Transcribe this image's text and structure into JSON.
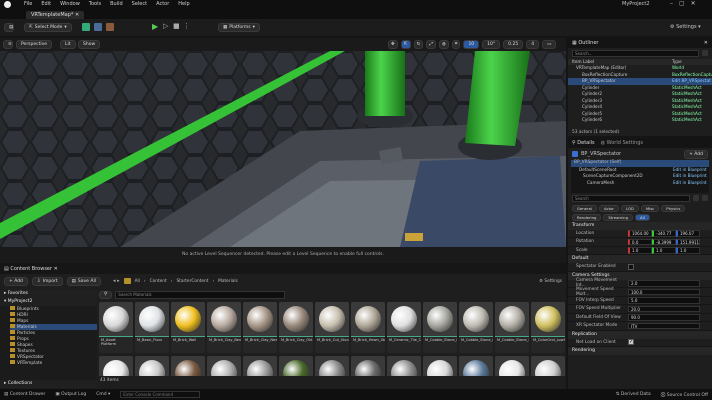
{
  "menu": [
    "File",
    "Edit",
    "Window",
    "Tools",
    "Build",
    "Select",
    "Actor",
    "Help"
  ],
  "project_name": "MyProject2",
  "level_tab": "VRTemplateMap*",
  "toolbar": {
    "select_mode": "Select Mode",
    "platforms": "Platforms",
    "settings": "Settings"
  },
  "viewport": {
    "perspective": "Perspective",
    "lit": "Lit",
    "show": "Show",
    "grid_value": "10",
    "rot_value": "10°",
    "scale_value": "0.25",
    "cam_speed": "4",
    "sequencer_msg": "No active Level Sequencer detected. Please edit a Level Sequence to enable full controls."
  },
  "outliner": {
    "title": "Outliner",
    "search": "Search...",
    "col_label": "Item Label",
    "col_type": "Type",
    "rows": [
      {
        "name": "VRTemplateMap (Editor)",
        "type": "World"
      },
      {
        "name": "BoxReflectionCapture",
        "type": "BoxReflectionCaptu"
      },
      {
        "name": "BP_VRSpectator",
        "type": "Edit BP_VRSpectat"
      },
      {
        "name": "Cylinder",
        "type": "StaticMeshAct"
      },
      {
        "name": "Cylinder2",
        "type": "StaticMeshAct"
      },
      {
        "name": "Cylinder3",
        "type": "StaticMeshAct"
      },
      {
        "name": "Cylinder4",
        "type": "StaticMeshAct"
      },
      {
        "name": "Cylinder5",
        "type": "StaticMeshAct"
      },
      {
        "name": "Cylinder6",
        "type": "StaticMeshAct"
      }
    ],
    "status": "53 actors (1 selected)"
  },
  "details": {
    "tab_details": "Details",
    "tab_world": "World Settings",
    "actor": "BP_VRSpectator",
    "add": "+ Add",
    "self": "BP_VRSpectator (Self)",
    "components": [
      {
        "name": "DefaultSceneRoot",
        "link": "Edit in Blueprint"
      },
      {
        "name": "SceneCaptureComponent2D",
        "link": "Edit in Blueprint"
      },
      {
        "name": "CameraMesh",
        "link": "Edit in Blueprint"
      }
    ],
    "search": "Search",
    "filters1": [
      "General",
      "Actor",
      "LOD",
      "Misc",
      "Physics"
    ],
    "filters2": [
      "Rendering",
      "Streaming",
      "All"
    ],
    "transform": "Transform",
    "location": {
      "label": "Location",
      "x": "1064.00",
      "y": "-340.77",
      "z": "196.07"
    },
    "rotation": {
      "label": "Rotation",
      "x": "0.0",
      "y": "-8.3999",
      "z": "151.9911"
    },
    "scale": {
      "label": "Scale",
      "x": "1.0",
      "y": "1.0",
      "z": "1.0"
    },
    "default": "Default",
    "spectator_enabled": "Spectator Enabled",
    "camera_settings": "Camera Settings",
    "cam_props": [
      {
        "k": "Camera Movement Int...",
        "v": "2.0"
      },
      {
        "k": "Movement Speed Mult...",
        "v": "100.0"
      },
      {
        "k": "FOV Interp Speed",
        "v": "5.0"
      },
      {
        "k": "FOV Speed Multiplier",
        "v": "20.0"
      },
      {
        "k": "Default Field Of View",
        "v": "90.0"
      },
      {
        "k": "XR Spectator Mode",
        "v": "ITV"
      }
    ],
    "replication": "Replication",
    "net_load": "Net Load on Client",
    "rendering": "Rendering"
  },
  "content_browser": {
    "title": "Content Browser",
    "add": "+ Add",
    "import": "Import",
    "save_all": "Save All",
    "path": [
      "All",
      "Content",
      "StarterContent",
      "Materials"
    ],
    "settings": "Settings",
    "favorites": "Favorites",
    "project": "MyProject2",
    "folders": [
      "Blueprints",
      "HDRI",
      "Maps",
      "Materials",
      "Particles",
      "Props",
      "Shapes",
      "Textures",
      "VRSpectator",
      "VRTemplate"
    ],
    "collections": "Collections",
    "search": "Search Materials",
    "count": "43 items",
    "items": [
      {
        "label": "M_Asset Platform",
        "color": "#d8d8d8"
      },
      {
        "label": "M_Basic_Floor",
        "color": "#dfe3e6"
      },
      {
        "label": "M_Brick_Wall",
        "color": "#f0c020"
      },
      {
        "label": "M_Brick_Clay_Beveled",
        "color": "#b8aaa0"
      },
      {
        "label": "M_Brick_Clay_New",
        "color": "#a89888"
      },
      {
        "label": "M_Brick_Clay_Old",
        "color": "#9a8a7c"
      },
      {
        "label": "M_Brick_Cut_Stone",
        "color": "#c8c0b0"
      },
      {
        "label": "M_Brick_Hewn_Stone",
        "color": "#b0a898"
      },
      {
        "label": "M_Ceramic_Tile_Checker",
        "color": "#e0e0e0"
      },
      {
        "label": "M_Cobble_Stone_Pebble",
        "color": "#a8a8a0"
      },
      {
        "label": "M_Cobble_Stone_Rough",
        "color": "#c0bcb4"
      },
      {
        "label": "M_Cobble_Stone_Smooth",
        "color": "#b4b0a8"
      },
      {
        "label": "M_ColorGrid_LowSpec",
        "color": "#d0c060"
      }
    ],
    "row2_colors": [
      "#e8e8e8",
      "#c8c8c8",
      "#7a5a40",
      "#b0b0b0",
      "#9a9a9a",
      "#4a6a2a",
      "#8a8a8a",
      "#6a6a6a",
      "#909090",
      "#d8d8d8",
      "#5a7a9a",
      "#e6e6e6",
      "#d0d0d0"
    ]
  },
  "status": {
    "drawer": "Content Drawer",
    "output": "Output Log",
    "cmd": "Cmd",
    "console": "Enter Console Command",
    "derived": "Derived Data",
    "source": "Source Control Off"
  }
}
